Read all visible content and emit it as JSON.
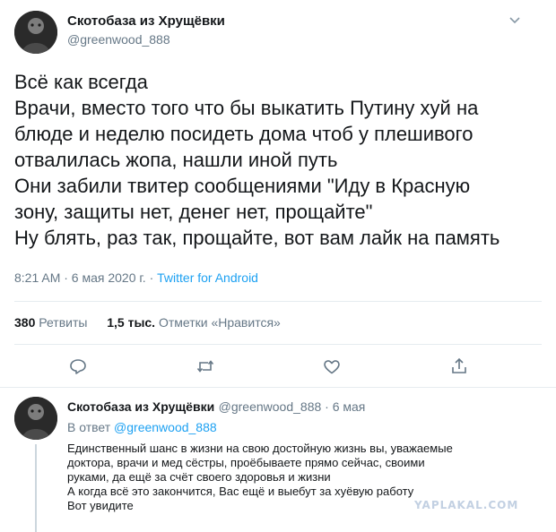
{
  "tweet": {
    "display_name": "Скотобаза из Хрущёвки",
    "handle": "@greenwood_888",
    "text_lines": [
      "Всё как всегда",
      "Врачи, вместо того что бы выкатить Путину хуй на",
      "блюде и неделю посидеть дома чтоб у плешивого",
      "отвалилась жопа, нашли иной путь",
      "Они забили твитер сообщениями \"Иду в Красную",
      "зону, защиты нет, денег нет, прощайте\"",
      "Ну блять, раз так, прощайте, вот вам лайк на память"
    ],
    "timestamp": "8:21 AM · 6 мая 2020 г. ·",
    "source": "Twitter for Android",
    "retweets_count": "380",
    "retweets_label": "Ретвиты",
    "likes_count": "1,5 тыс.",
    "likes_label": "Отметки «Нравится»",
    "menu_icon": "chevron-down-icon",
    "actions": [
      "reply-icon",
      "retweet-icon",
      "like-icon",
      "share-icon"
    ]
  },
  "reply": {
    "display_name": "Скотобаза из Хрущёвки",
    "handle_date": "@greenwood_888 · 6 мая",
    "in_reply_prefix": "В ответ",
    "in_reply_handle": "@greenwood_888",
    "text_lines": [
      "Единственный шанс в жизни на свою достойную жизнь вы, уважаемые",
      "доктора, врачи и мед сёстры, проёбываете прямо сейчас, своими",
      "руками, да ещё за счёт своего здоровья и жизни",
      "А когда всё это закончится, Вас ещё и выебут за хуёвую работу",
      "Вот увидите"
    ]
  },
  "watermark": "YAPLAKAL.COM",
  "colors": {
    "link": "#1da1f2",
    "secondary": "#657786",
    "divider": "#e6ecf0"
  }
}
